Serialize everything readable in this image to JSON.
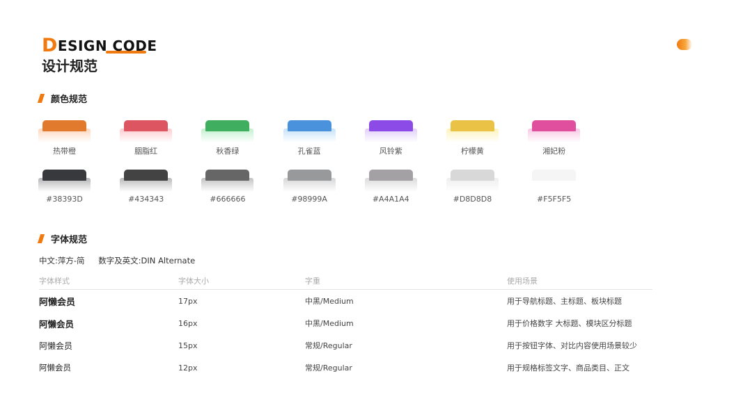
{
  "header": {
    "title_initial": "D",
    "title_rest": "ESIGN CODE",
    "subtitle": "设计规范",
    "accent": "#F07A10"
  },
  "color_section": {
    "title": "颜色规范",
    "brand_colors": [
      {
        "name": "热带橙",
        "top": "#E27A2E",
        "tint": "#FFD6BE"
      },
      {
        "name": "胭脂红",
        "top": "#DC5560",
        "tint": "#FFCBCF"
      },
      {
        "name": "秋香绿",
        "top": "#3FAE5E",
        "tint": "#C3F0CF"
      },
      {
        "name": "孔雀蓝",
        "top": "#4A93DC",
        "tint": "#C6E2FA"
      },
      {
        "name": "风铃紫",
        "top": "#8C4BE6",
        "tint": "#E1CFFA"
      },
      {
        "name": "柠檬黄",
        "top": "#E9C246",
        "tint": "#FFF3BC"
      },
      {
        "name": "湘妃粉",
        "top": "#E04F9E",
        "tint": "#FAC8E4"
      }
    ],
    "gray_colors": [
      {
        "name": "#38393D",
        "top": "#38393D",
        "tint": "#B4B4B6"
      },
      {
        "name": "#434343",
        "top": "#434343",
        "tint": "#B9B9B9"
      },
      {
        "name": "#666666",
        "top": "#666666",
        "tint": "#C3C3C3"
      },
      {
        "name": "#98999A",
        "top": "#98999A",
        "tint": "#D6D6D7"
      },
      {
        "name": "#A4A1A4",
        "top": "#A4A1A4",
        "tint": "#DCDBDC"
      },
      {
        "name": "#D8D8D8",
        "top": "#D8D8D8",
        "tint": "#EEEEEE"
      },
      {
        "name": "#F5F5F5",
        "top": "#F5F5F5",
        "tint": "#FFFFFF"
      }
    ]
  },
  "font_section": {
    "title": "字体规范",
    "cn_font": "中文:萍方-简",
    "en_font": "数字及英文:DIN Alternate",
    "columns": [
      "字体样式",
      "字体大小",
      "字重",
      "使用场景"
    ],
    "rows": [
      {
        "sample": "阿懒会员",
        "size": "17px",
        "weight": "中黑/Medium",
        "usage": "用于导航标题、主标题、板块标题"
      },
      {
        "sample": "阿懒会员",
        "size": "16px",
        "weight": "中黑/Medium",
        "usage": "用于价格数字 大标题、模块区分标题"
      },
      {
        "sample": "阿懒会员",
        "size": "15px",
        "weight": "常规/Regular",
        "usage": "用于按钮字体、对比内容使用场景较少"
      },
      {
        "sample": "阿懒会员",
        "size": "12px",
        "weight": "常规/Regular",
        "usage": "用于规格标签文字、商品类目、正文"
      }
    ]
  }
}
